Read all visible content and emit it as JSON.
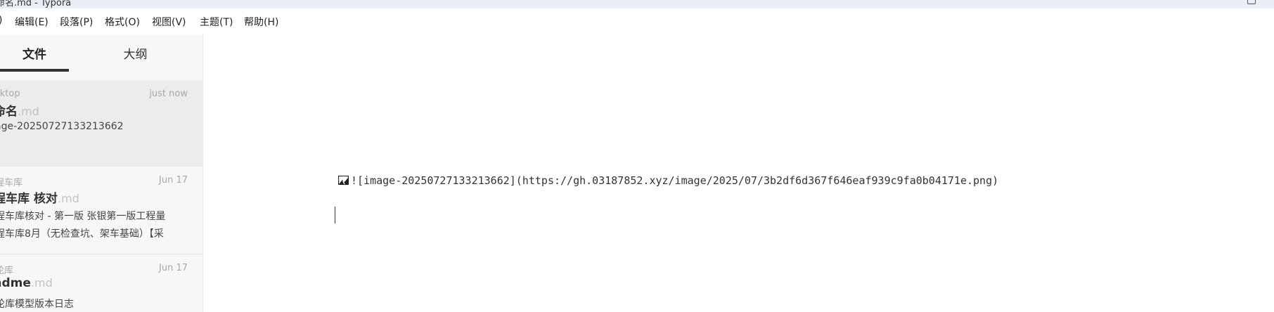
{
  "window": {
    "title": "命名.md - Typora"
  },
  "menu": {
    "items": [
      {
        "label": ")"
      },
      {
        "label": "编辑(E)"
      },
      {
        "label": "段落(P)"
      },
      {
        "label": "格式(O)"
      },
      {
        "label": "视图(V)"
      },
      {
        "label": "主题(T)"
      },
      {
        "label": "帮助(H)"
      }
    ]
  },
  "sidebar": {
    "tabs": [
      {
        "label": "文件",
        "active": true
      },
      {
        "label": "大纲",
        "active": false
      }
    ],
    "files": [
      {
        "folder": "sktop",
        "date": "just now",
        "name": "命名",
        "ext": ".md",
        "excerpt": [
          "age-20250727133213662"
        ],
        "active": true
      },
      {
        "folder": "程车库",
        "date": "Jun 17",
        "name": "程车库 核对",
        "ext": ".md",
        "excerpt": [
          "程车库核对 - 第一版 张银第一版工程量",
          "程车库8月（无检查坑、架车基础）【采"
        ],
        "active": false
      },
      {
        "folder": "轮库",
        "date": "Jun 17",
        "name": "adme",
        "ext": ".md",
        "excerpt": [
          "轮库模型版本日志"
        ],
        "active": false
      }
    ]
  },
  "editor": {
    "line": "![image-20250727133213662](https://gh.03187852.xyz/image/2025/07/3b2df6d367f646eaf939c9fa0b04171e.png)"
  },
  "colors": {
    "titlebar_bg": "#e9eef5",
    "sidebar_bg": "#f7f7f7",
    "active_file_bg": "#ececec",
    "muted_text": "#a8a8a8"
  }
}
